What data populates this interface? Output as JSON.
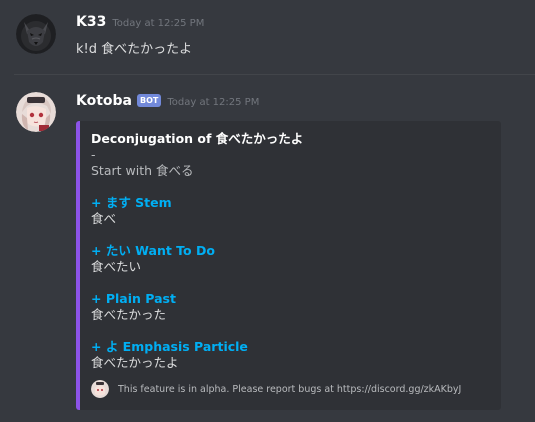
{
  "messages": [
    {
      "username": "K33",
      "timestamp": "Today at 12:25 PM",
      "content": "k!d 食べたかったよ"
    },
    {
      "username": "Kotoba",
      "bot_tag": "BOT",
      "timestamp": "Today at 12:25 PM"
    }
  ],
  "embed": {
    "title": "Deconjugation of 食べたかったよ",
    "separator": "-",
    "start_line": "Start with 食べる",
    "fields": [
      {
        "name": "+ ます Stem",
        "value": "食べ"
      },
      {
        "name": "+ たい Want To Do",
        "value": "食べたい"
      },
      {
        "name": "+ Plain Past",
        "value": "食べたかった"
      },
      {
        "name": "+ よ Emphasis Particle",
        "value": "食べたかったよ"
      }
    ],
    "footer_text": "This feature is in alpha. Please report bugs at https://discord.gg/zkAKbyJ",
    "accent_color": "#8c53e8"
  },
  "icons": {
    "user_avatar": "wolf-avatar-icon",
    "bot_avatar": "anime-girl-avatar-icon"
  }
}
